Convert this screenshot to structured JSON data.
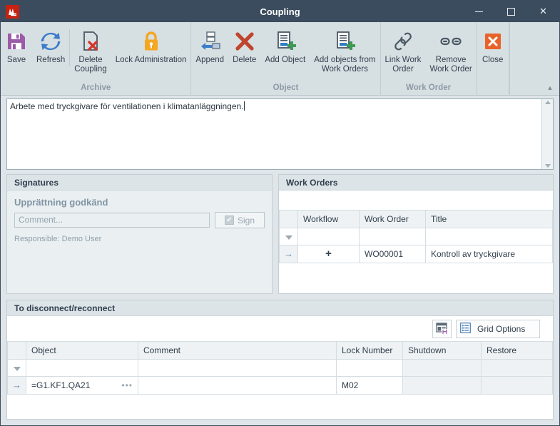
{
  "window": {
    "title": "Coupling",
    "app_icon": "app-logo-icon",
    "controls": {
      "minimize": "minimize-icon",
      "maximize": "maximize-icon",
      "close": "close-icon"
    }
  },
  "ribbon": {
    "collapse_glyph": "▲",
    "groups": [
      {
        "label": "Archive",
        "buttons": [
          {
            "label": "Save",
            "icon": "save-floppy-icon"
          },
          {
            "label": "Refresh",
            "icon": "refresh-arrows-icon"
          },
          {
            "label": "Delete\nCoupling",
            "icon": "delete-coupling-icon"
          },
          {
            "label": "Lock Administration",
            "icon": "padlock-icon"
          }
        ]
      },
      {
        "label": "Object",
        "buttons": [
          {
            "label": "Append",
            "icon": "append-arrow-icon"
          },
          {
            "label": "Delete",
            "icon": "red-x-icon"
          },
          {
            "label": "Add Object",
            "icon": "add-object-icon"
          },
          {
            "label": "Add objects from\nWork Orders",
            "icon": "add-objects-from-work-orders-icon"
          }
        ]
      },
      {
        "label": "Work Order",
        "buttons": [
          {
            "label": "Link Work\nOrder",
            "icon": "chain-link-icon"
          },
          {
            "label": "Remove\nWork Order",
            "icon": "broken-link-icon"
          }
        ]
      },
      {
        "label": "",
        "buttons": [
          {
            "label": "Close",
            "icon": "close-x-box-icon"
          }
        ]
      }
    ]
  },
  "description": {
    "value": "Arbete med tryckgivare för ventilationen i klimatanläggningen.",
    "scroll_up": "scroll-up-arrow-icon",
    "scroll_down": "scroll-down-arrow-icon"
  },
  "signatures": {
    "panel_title": "Signatures",
    "section_title": "Upprättning godkänd",
    "comment_placeholder": "Comment...",
    "comment_value": "",
    "sign_label": "Sign",
    "sign_check": "✔",
    "responsible": "Responsible: Demo User"
  },
  "work_orders": {
    "panel_title": "Work Orders",
    "columns": [
      "",
      "Workflow",
      "Work Order",
      "Title"
    ],
    "filter_icon": "filter-funnel-icon",
    "rows": [
      {
        "indicator": "→",
        "workflow": "+",
        "work_order": "WO00001",
        "title": "Kontroll av tryckgivare"
      }
    ]
  },
  "disconnect": {
    "panel_title": "To disconnect/reconnect",
    "toolbar": {
      "layout_button_icon": "save-layout-icon",
      "grid_options_icon": "list-options-icon",
      "grid_options_label": "Grid Options"
    },
    "columns": [
      "",
      "Object",
      "Comment",
      "Lock Number",
      "Shutdown",
      "Restore"
    ],
    "filter_icon": "filter-funnel-icon",
    "rows": [
      {
        "indicator": "→",
        "object": "=G1.KF1.QA21",
        "object_ellipsis": "•••",
        "comment": "",
        "lock_number": "M02",
        "shutdown": "",
        "restore": ""
      }
    ]
  },
  "colors": {
    "titlebar": "#3b4c5e",
    "ribbon": "#d6dfe2",
    "accent_red": "#c62111",
    "accent_orange": "#e8622a",
    "accent_purple": "#9b5ba8",
    "accent_blue": "#3d7cc9",
    "accent_green": "#3d9a52",
    "accent_yellow": "#f5a623"
  }
}
